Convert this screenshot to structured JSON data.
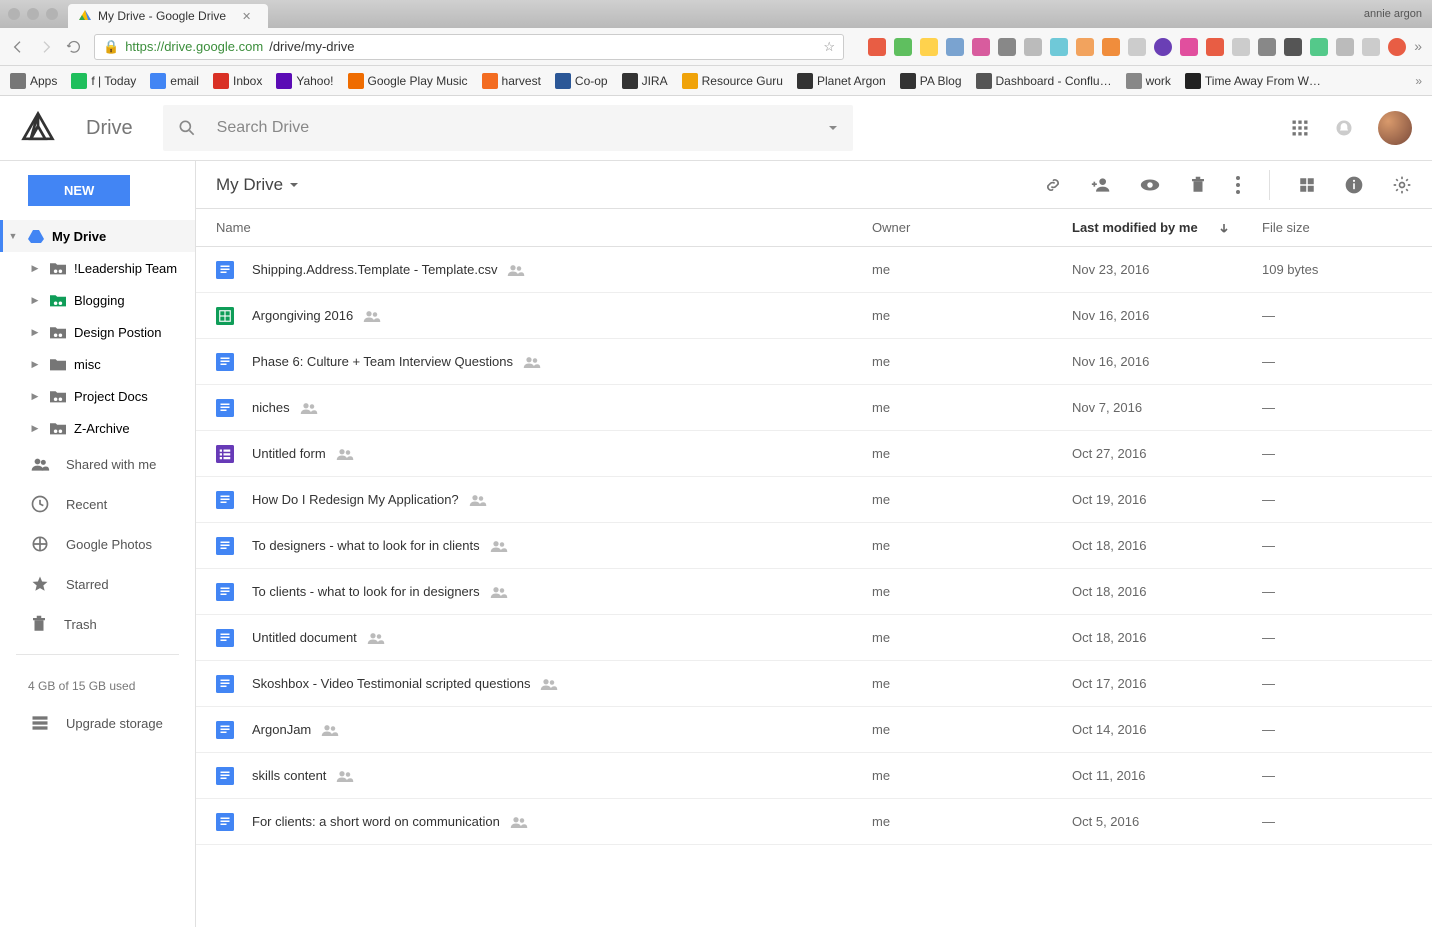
{
  "browser": {
    "profile": "annie argon",
    "tab_title": "My Drive - Google Drive",
    "url_host": "https://drive.google.com",
    "url_path": "/drive/my-drive"
  },
  "bookmarks": [
    {
      "label": "Apps",
      "color": "#777"
    },
    {
      "label": "f | Today",
      "color": "#1fbf5c"
    },
    {
      "label": "email",
      "color": "#4285f4"
    },
    {
      "label": "Inbox",
      "color": "#d93025"
    },
    {
      "label": "Yahoo!",
      "color": "#5b0bb5"
    },
    {
      "label": "Google Play Music",
      "color": "#ef6c00"
    },
    {
      "label": "harvest",
      "color": "#f36c21"
    },
    {
      "label": "Co-op",
      "color": "#2b5797"
    },
    {
      "label": "JIRA",
      "color": "#333"
    },
    {
      "label": "Resource Guru",
      "color": "#f0a30a"
    },
    {
      "label": "Planet Argon",
      "color": "#333"
    },
    {
      "label": "PA Blog",
      "color": "#333"
    },
    {
      "label": "Dashboard - Conflu…",
      "color": "#555"
    },
    {
      "label": "work",
      "color": "#888"
    },
    {
      "label": "Time Away From W…",
      "color": "#222"
    }
  ],
  "app": {
    "brand": "Drive",
    "search_placeholder": "Search Drive",
    "new_button": "NEW",
    "breadcrumb": "My Drive"
  },
  "sidebar": {
    "root": "My Drive",
    "folders": [
      {
        "label": "!Leadership Team",
        "shared": true
      },
      {
        "label": "Blogging",
        "shared": true,
        "green": true
      },
      {
        "label": "Design Postion",
        "shared": true
      },
      {
        "label": "misc",
        "shared": false
      },
      {
        "label": "Project Docs",
        "shared": true
      },
      {
        "label": "Z-Archive",
        "shared": true
      }
    ],
    "items": [
      {
        "label": "Shared with me",
        "icon": "people"
      },
      {
        "label": "Recent",
        "icon": "clock"
      },
      {
        "label": "Google Photos",
        "icon": "photos"
      },
      {
        "label": "Starred",
        "icon": "star"
      },
      {
        "label": "Trash",
        "icon": "trash"
      }
    ],
    "storage": "4 GB of 15 GB used",
    "upgrade": "Upgrade storage"
  },
  "columns": {
    "name": "Name",
    "owner": "Owner",
    "modified": "Last modified by me",
    "size": "File size"
  },
  "files": [
    {
      "type": "doc",
      "name": "Shipping.Address.Template - Template.csv",
      "owner": "me",
      "modified": "Nov 23, 2016",
      "size": "109 bytes",
      "shared": true
    },
    {
      "type": "sheet",
      "name": "Argongiving 2016",
      "owner": "me",
      "modified": "Nov 16, 2016",
      "size": "—",
      "shared": true
    },
    {
      "type": "doc",
      "name": "Phase 6: Culture + Team Interview Questions",
      "owner": "me",
      "modified": "Nov 16, 2016",
      "size": "—",
      "shared": true
    },
    {
      "type": "doc",
      "name": "niches",
      "owner": "me",
      "modified": "Nov 7, 2016",
      "size": "—",
      "shared": true
    },
    {
      "type": "form",
      "name": "Untitled form",
      "owner": "me",
      "modified": "Oct 27, 2016",
      "size": "—",
      "shared": true
    },
    {
      "type": "doc",
      "name": "How Do I Redesign My Application?",
      "owner": "me",
      "modified": "Oct 19, 2016",
      "size": "—",
      "shared": true
    },
    {
      "type": "doc",
      "name": "To designers - what to look for in clients",
      "owner": "me",
      "modified": "Oct 18, 2016",
      "size": "—",
      "shared": true
    },
    {
      "type": "doc",
      "name": "To clients - what to look for in designers",
      "owner": "me",
      "modified": "Oct 18, 2016",
      "size": "—",
      "shared": true
    },
    {
      "type": "doc",
      "name": "Untitled document",
      "owner": "me",
      "modified": "Oct 18, 2016",
      "size": "—",
      "shared": true
    },
    {
      "type": "doc",
      "name": "Skoshbox - Video Testimonial scripted questions",
      "owner": "me",
      "modified": "Oct 17, 2016",
      "size": "—",
      "shared": true
    },
    {
      "type": "doc",
      "name": "ArgonJam",
      "owner": "me",
      "modified": "Oct 14, 2016",
      "size": "—",
      "shared": true
    },
    {
      "type": "doc",
      "name": "skills content",
      "owner": "me",
      "modified": "Oct 11, 2016",
      "size": "—",
      "shared": true
    },
    {
      "type": "doc",
      "name": "For clients: a short word on communication",
      "owner": "me",
      "modified": "Oct 5, 2016",
      "size": "—",
      "shared": true
    }
  ]
}
